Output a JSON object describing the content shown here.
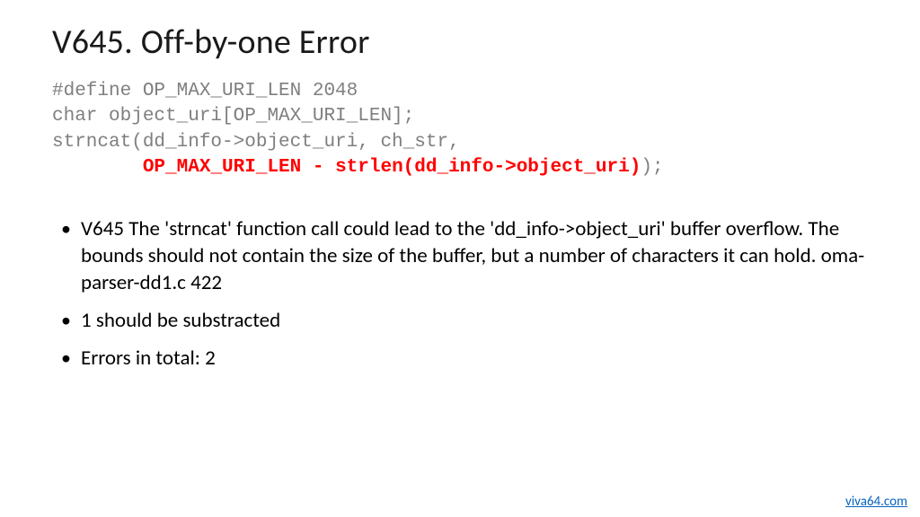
{
  "title": "V645. Off-by-one Error",
  "code": {
    "line1": "#define OP_MAX_URI_LEN 2048",
    "line2": "char object_uri[OP_MAX_URI_LEN];",
    "line3": "",
    "line4": "strncat(dd_info->object_uri, ch_str,",
    "line5_indent": "        ",
    "line5_highlight": "OP_MAX_URI_LEN - strlen(dd_info->object_uri)",
    "line5_tail": ");"
  },
  "bullets": [
    "V645 The 'strncat' function call could lead to the 'dd_info->object_uri' buffer overflow. The bounds should not contain the size of the buffer, but a number of characters it can hold. oma-parser-dd1.c 422",
    "1 should be substracted",
    "Errors in total: 2"
  ],
  "footer_link": "viva64.com"
}
